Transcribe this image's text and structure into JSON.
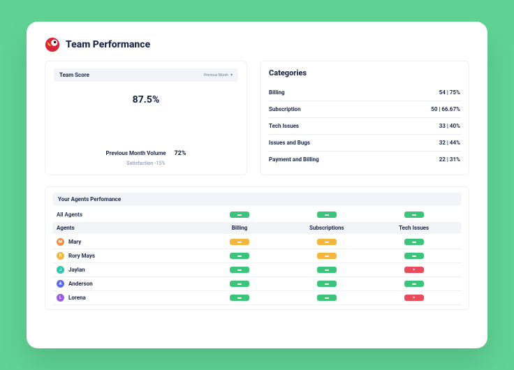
{
  "page_title": "Team Performance",
  "team_score": {
    "header_label": "Team Score",
    "dropdown_label": "Previous Month",
    "score_value": "87.5%",
    "prev_label": "Previous Month Volume",
    "prev_value": "72%",
    "satisfaction_label": "Satisfaction -15%"
  },
  "categories": {
    "title": "Categories",
    "rows": [
      {
        "name": "Billing",
        "value": "54 | 75%"
      },
      {
        "name": "Subscription",
        "value": "50 | 66.67%"
      },
      {
        "name": "Tech Issues",
        "value": "33 | 40%"
      },
      {
        "name": "Issues and Bugs",
        "value": "32 | 44%"
      },
      {
        "name": "Payment and Billing",
        "value": "22 | 31%"
      }
    ]
  },
  "agents": {
    "panel_title": "Your Agents Perfomance",
    "all_agents_label": "All Agents",
    "all_agents_chips": [
      "green",
      "green",
      "green"
    ],
    "columns": [
      "Agents",
      "Billing",
      "Subscriptions",
      "Tech Issues"
    ],
    "rows": [
      {
        "name": "Mary",
        "color": "#f5893d",
        "chips": [
          "yellow",
          "yellow",
          "green"
        ]
      },
      {
        "name": "Rory Mays",
        "color": "#f5b63d",
        "chips": [
          "green",
          "yellow",
          "green"
        ]
      },
      {
        "name": "Jaylan",
        "color": "#2fc3a7",
        "chips": [
          "green",
          "green",
          "red"
        ]
      },
      {
        "name": "Anderson",
        "color": "#5b6af0",
        "chips": [
          "green",
          "green",
          "green"
        ]
      },
      {
        "name": "Lorena",
        "color": "#9a5be0",
        "chips": [
          "green",
          "green",
          "red"
        ]
      }
    ]
  }
}
